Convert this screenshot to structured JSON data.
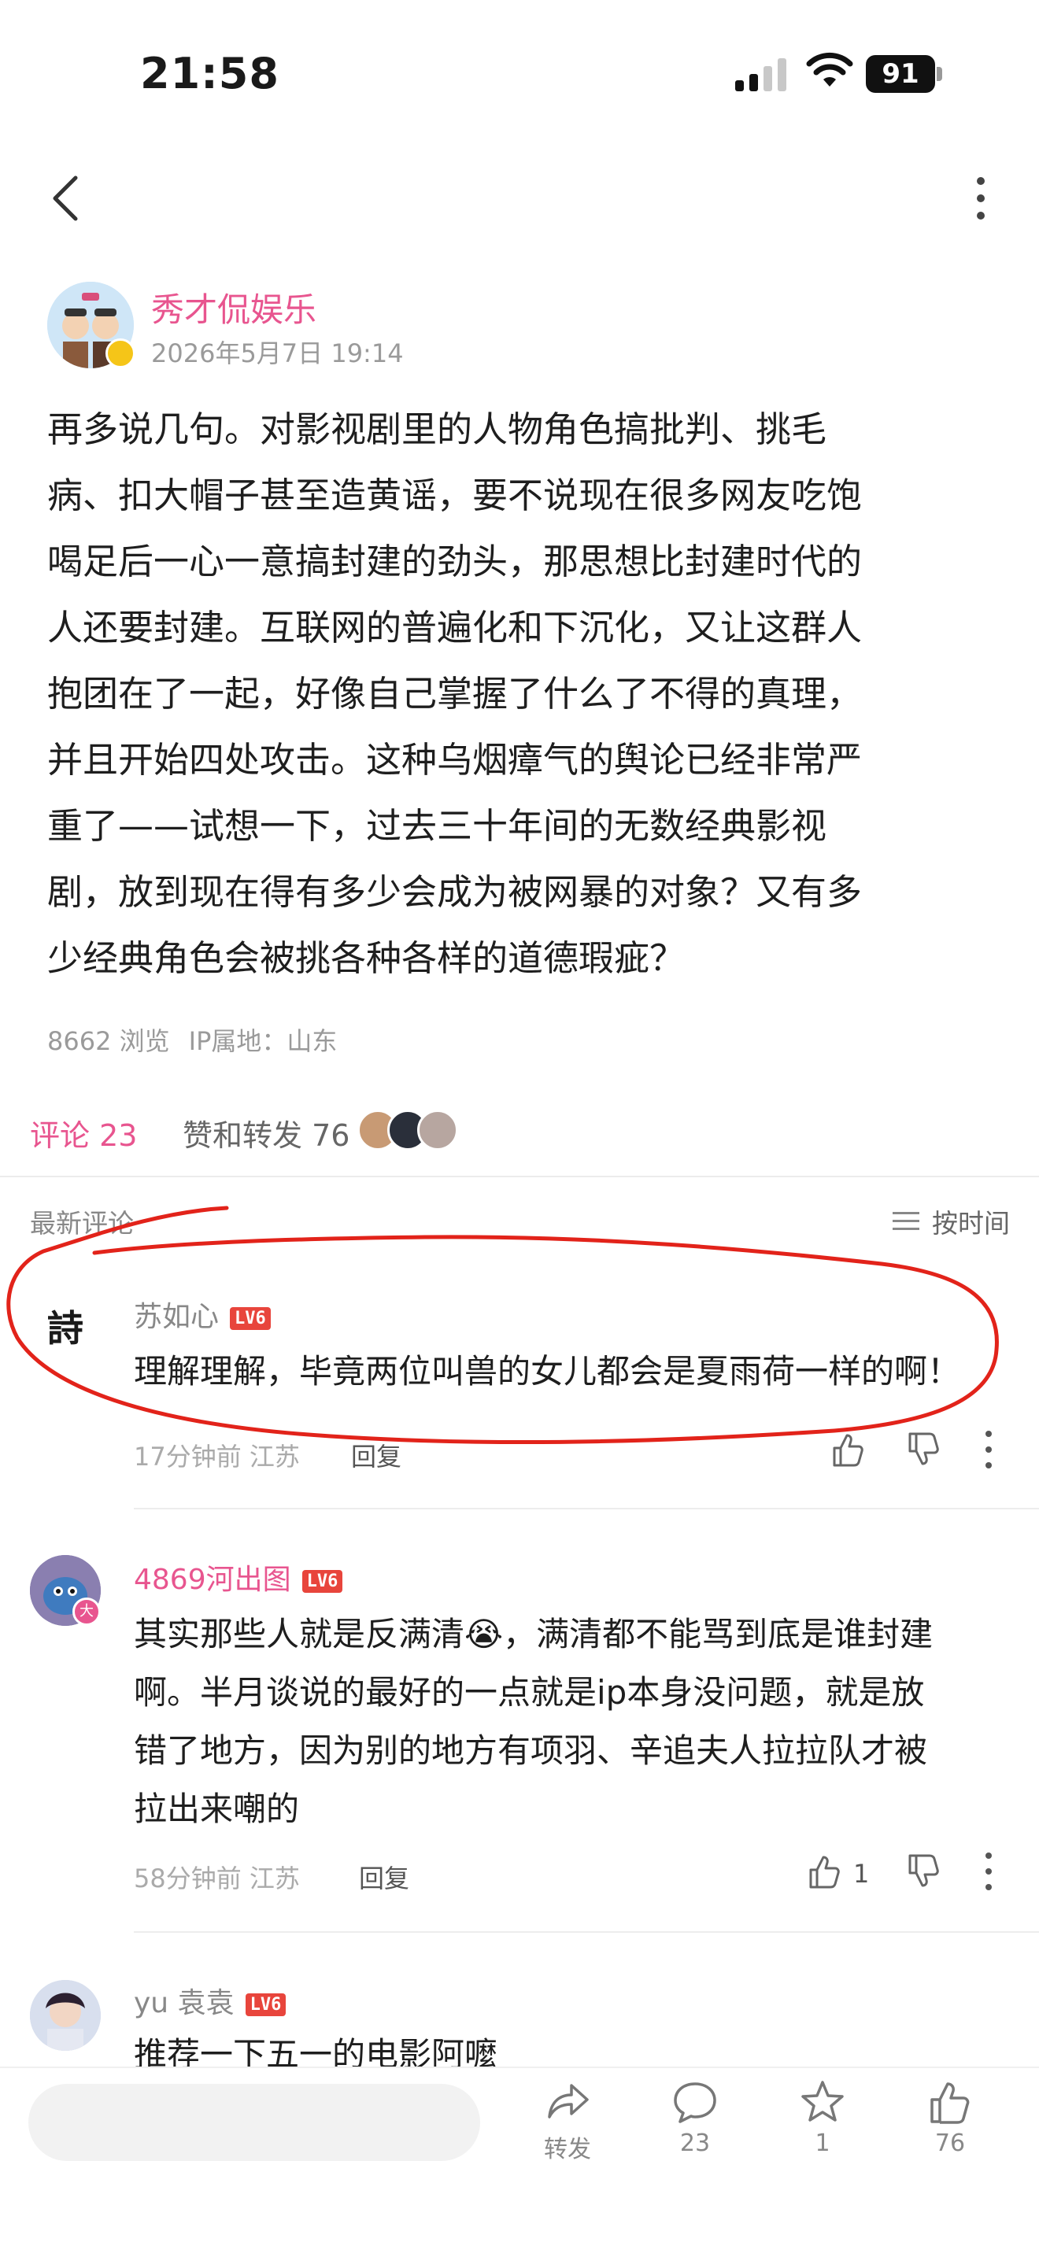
{
  "status_bar": {
    "time": "21:58",
    "battery": "91"
  },
  "post": {
    "author": "秀才侃娱乐",
    "time": "2026年5月7日 19:14",
    "lines": [
      "再多说几句。对影视剧里的人物角色搞批判、挑毛",
      "病、扣大帽子甚至造黄谣，要不说现在很多网友吃饱",
      "喝足后一心一意搞封建的劲头，那思想比封建时代的",
      "人还要封建。互联网的普遍化和下沉化，又让这群人",
      "抱团在了一起，好像自己掌握了什么了不得的真理，",
      "并且开始四处攻击。这种乌烟瘴气的舆论已经非常严",
      "重了——试想一下，过去三十年间的无数经典影视",
      "剧，放到现在得有多少会成为被网暴的对象？又有多",
      "少经典角色会被挑各种各样的道德瑕疵？"
    ],
    "views": "8662 浏览",
    "ip": "IP属地：山东"
  },
  "tabs": {
    "comments": "评论 23",
    "likes": "赞和转发 76"
  },
  "sort": {
    "label": "最新评论",
    "toggle": "按时间"
  },
  "comments": [
    {
      "avatar_char": "詩",
      "name": "苏如心",
      "level": "LV6",
      "text": "理解理解，毕竟两位叫兽的女儿都会是夏雨荷一样的啊！",
      "time": "17分钟前",
      "location": "江苏",
      "reply": "回复",
      "likes": ""
    },
    {
      "name": "4869河出图",
      "level": "LV6",
      "lines": [
        "其实那些人就是反满清😭，满清都不能骂到底是谁封建",
        "啊。半月谈说的最好的一点就是ip本身没问题，就是放",
        "错了地方，因为别的地方有项羽、辛追夫人拉拉队才被",
        "拉出来嘲的"
      ],
      "time": "58分钟前",
      "location": "江苏",
      "reply": "回复",
      "likes": "1",
      "badge_char": "大"
    },
    {
      "name": "yu 袁袁",
      "level": "LV6",
      "text": "推荐一下五一的电影阿嚒"
    }
  ],
  "bottom_bar": {
    "repost_label": "转发",
    "comment_count": "23",
    "favorite_count": "1",
    "like_count": "76"
  },
  "colors": {
    "accent": "#e8558f",
    "annotation": "#e2231a",
    "level_badge": "#e8453c"
  }
}
